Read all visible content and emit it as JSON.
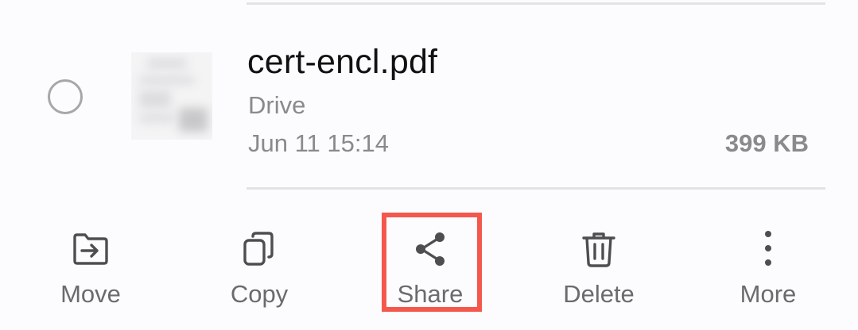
{
  "file": {
    "name": "cert-encl.pdf",
    "location": "Drive",
    "date": "Jun 11 15:14",
    "size": "399 KB",
    "thumbnail_icon": "pdf-thumbnail-icon",
    "selected": false
  },
  "toolbar": {
    "items": [
      {
        "label": "Move",
        "icon": "move-to-folder-icon"
      },
      {
        "label": "Copy",
        "icon": "copy-icon"
      },
      {
        "label": "Share",
        "icon": "share-icon"
      },
      {
        "label": "Delete",
        "icon": "trash-icon"
      },
      {
        "label": "More",
        "icon": "more-vertical-icon"
      }
    ],
    "highlighted": "Share"
  },
  "colors": {
    "background": "#fcfcfe",
    "primary_text": "#111111",
    "secondary_text": "#8a8a8d",
    "toolbar_text": "#6b6b6e",
    "icon": "#4e4e51",
    "highlight_border": "#f4584c",
    "divider": "#e3e3e6"
  }
}
